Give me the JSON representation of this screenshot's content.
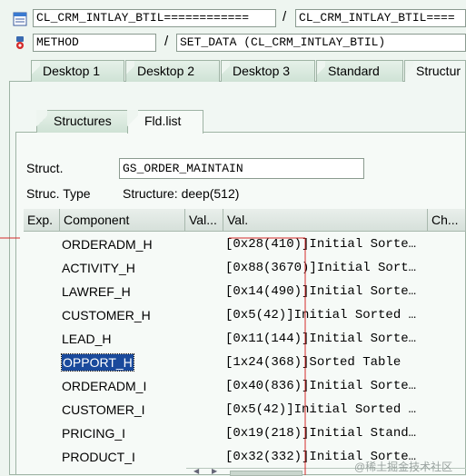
{
  "header": {
    "row1": {
      "field1": "CL_CRM_INTLAY_BTIL============",
      "separator": "/",
      "field2": "CL_CRM_INTLAY_BTIL===="
    },
    "row2": {
      "field1": "METHOD",
      "separator": "/",
      "field2": "SET_DATA (CL_CRM_INTLAY_BTIL)"
    }
  },
  "tabs": [
    "Desktop 1",
    "Desktop 2",
    "Desktop 3",
    "Standard",
    "Structur"
  ],
  "subtabs": [
    "Structures",
    "Fld.list"
  ],
  "struct": {
    "label": "Struct.",
    "value": "GS_ORDER_MAINTAIN",
    "type_label": "Struc. Type",
    "type_value": "Structure: deep(512)"
  },
  "table": {
    "columns": [
      "Exp.",
      "Component",
      "Val...",
      "Val.",
      "Ch..."
    ],
    "rows": [
      {
        "component": "ORDERADM_H",
        "value": "[0x28(410)]Initial Sorte…"
      },
      {
        "component": "ACTIVITY_H",
        "value": "[0x88(3670)]Initial Sort…"
      },
      {
        "component": "LAWREF_H",
        "value": "[0x14(490)]Initial Sorte…"
      },
      {
        "component": "CUSTOMER_H",
        "value": "[0x5(42)]Initial Sorted …"
      },
      {
        "component": "LEAD_H",
        "value": "[0x11(144)]Initial Sorte…"
      },
      {
        "component": "OPPORT_H",
        "value": "[1x24(368)]Sorted Table"
      },
      {
        "component": "ORDERADM_I",
        "value": "[0x40(836)]Initial Sorte…"
      },
      {
        "component": "CUSTOMER_I",
        "value": "[0x5(42)]Initial Sorted …"
      },
      {
        "component": "PRICING_I",
        "value": "[0x19(218)]Initial Stand…"
      },
      {
        "component": "PRODUCT_I",
        "value": "[0x32(332)]Initial Sorte…"
      }
    ]
  },
  "watermark": "@稀土掘金技术社区",
  "colors": {
    "background": "#eef5f0",
    "selection": "#1a4a9c",
    "annotation": "#d42a2a"
  }
}
